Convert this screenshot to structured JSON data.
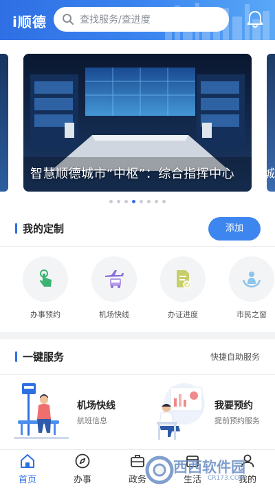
{
  "header": {
    "logo": "i顺德",
    "search_placeholder": "查找服务/查进度",
    "accent": "#2f6fe4"
  },
  "carousel": {
    "caption": "智慧顺德城市“中枢”：综合指挥中心",
    "next_caption_partial": "城",
    "slide_count": 8,
    "active_index": 3
  },
  "custom": {
    "title": "我的定制",
    "add_label": "添加",
    "items": [
      {
        "label": "办事预约",
        "icon": "hand-pointer-icon",
        "color": "#3cb371"
      },
      {
        "label": "机场快线",
        "icon": "plane-bus-icon",
        "color": "#8a6fd8"
      },
      {
        "label": "办证进度",
        "icon": "document-progress-icon",
        "color": "#c7cf6a"
      },
      {
        "label": "市民之窗",
        "icon": "citizen-window-icon",
        "color": "#8cc4ec"
      }
    ]
  },
  "service": {
    "title": "一键服务",
    "more": "快捷自助服务",
    "cards": [
      {
        "title": "机场快线",
        "subtitle": "航班信息",
        "icon": "bus-stop-illustration"
      },
      {
        "title": "我要预约",
        "subtitle": "提前预约服务",
        "icon": "appointment-illustration"
      }
    ]
  },
  "tabbar": {
    "tabs": [
      {
        "label": "首页",
        "icon": "home-icon",
        "active": true
      },
      {
        "label": "办事",
        "icon": "compass-icon",
        "active": false
      },
      {
        "label": "政务",
        "icon": "briefcase-icon",
        "active": false
      },
      {
        "label": "生活",
        "icon": "life-icon",
        "active": false
      },
      {
        "label": "我的",
        "icon": "user-icon",
        "active": false
      }
    ]
  },
  "watermark": {
    "text": "西西软件园",
    "url": "CR173.COM"
  }
}
